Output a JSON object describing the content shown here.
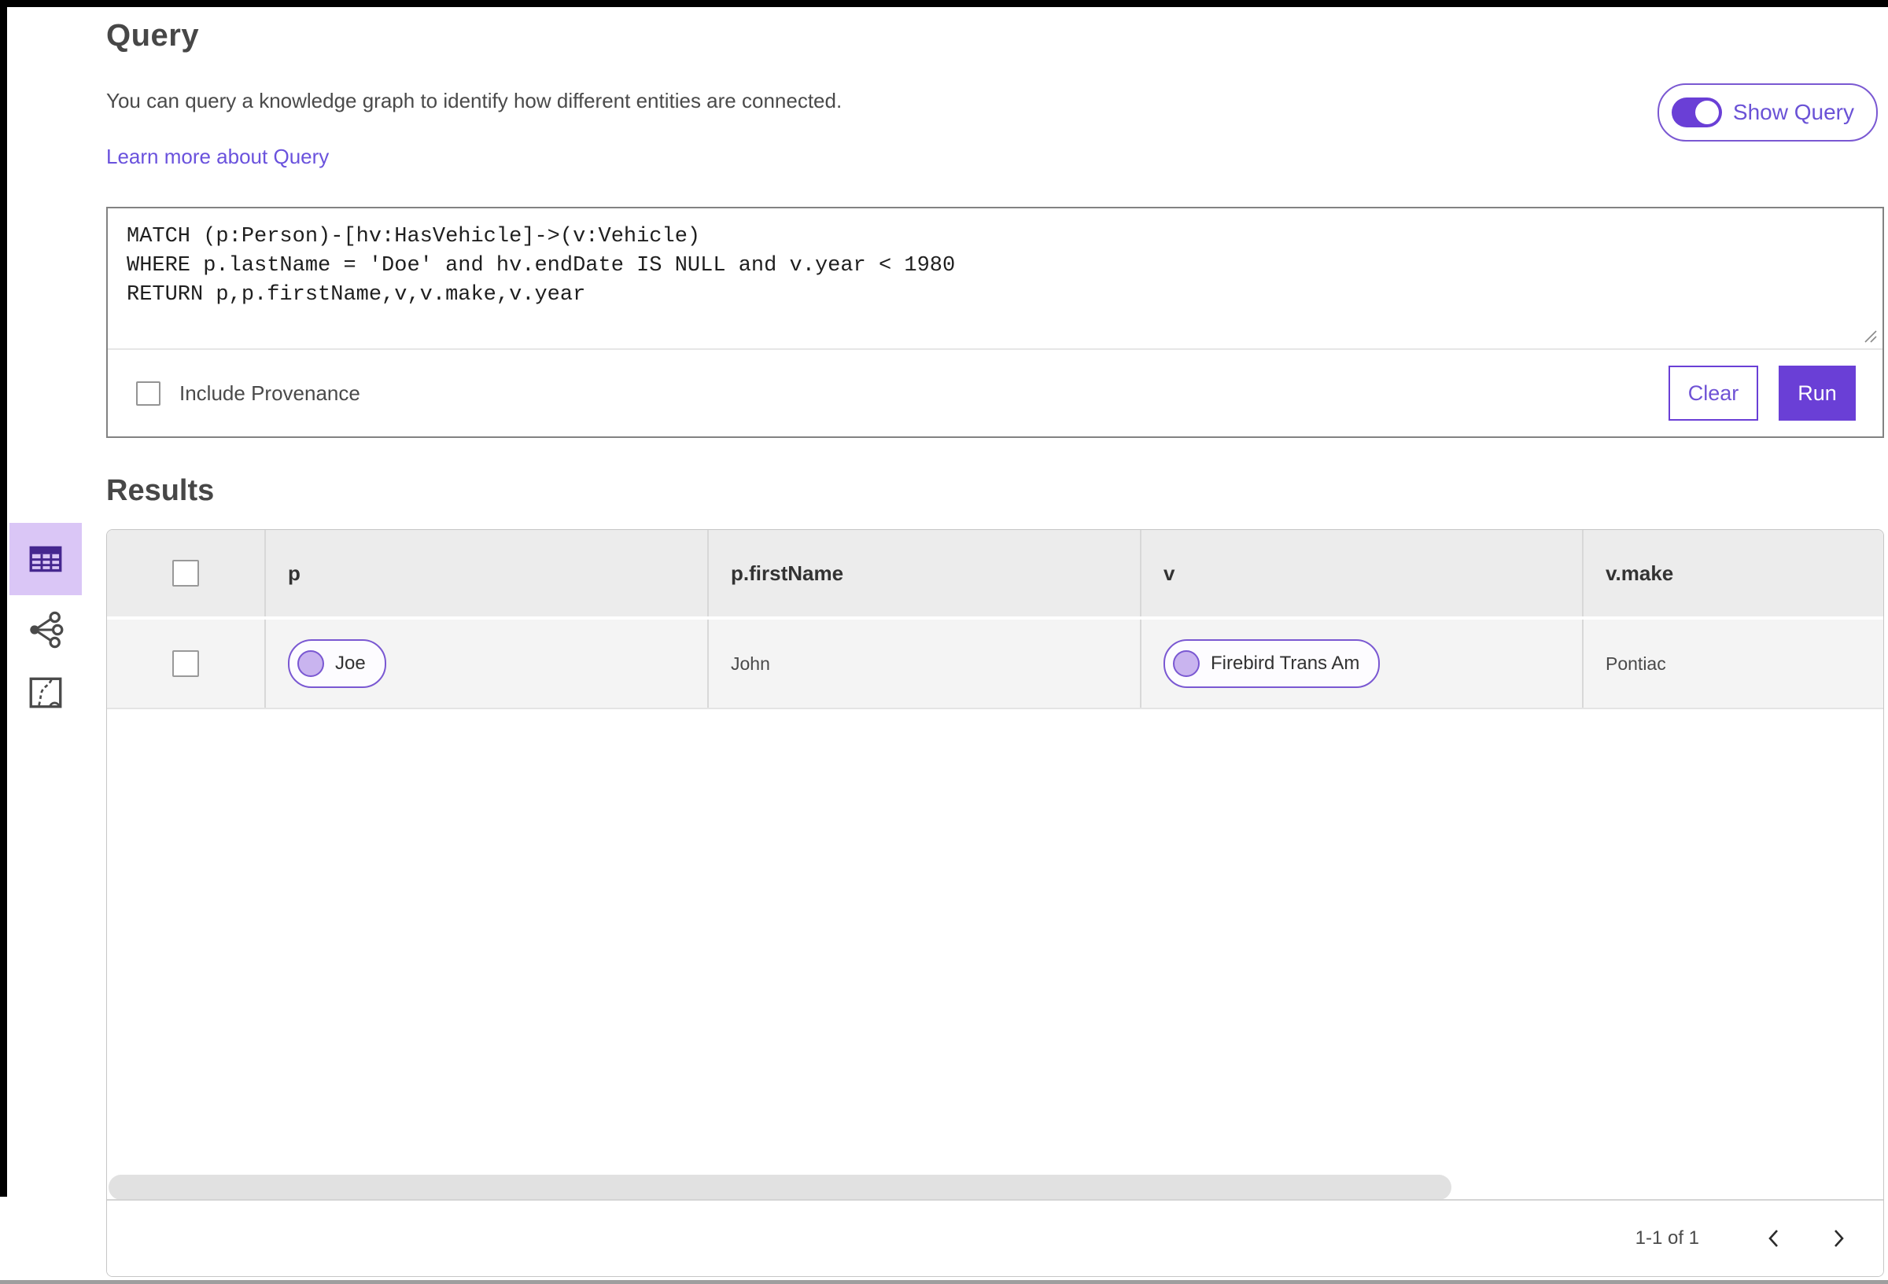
{
  "page": {
    "title": "Query",
    "description": "You can query a knowledge graph to identify how different entities are connected.",
    "learn_more_label": "Learn more about Query",
    "show_query_label": "Show Query"
  },
  "query_panel": {
    "query_text": "MATCH (p:Person)-[hv:HasVehicle]->(v:Vehicle)\nWHERE p.lastName = 'Doe' and hv.endDate IS NULL and v.year < 1980\nRETURN p,p.firstName,v,v.make,v.year",
    "include_provenance_label": "Include Provenance",
    "clear_label": "Clear",
    "run_label": "Run"
  },
  "results": {
    "heading": "Results",
    "views": [
      {
        "name": "table-view",
        "selected": true
      },
      {
        "name": "link-chart-view",
        "selected": false
      },
      {
        "name": "map-view",
        "selected": false
      }
    ],
    "table": {
      "columns": [
        "p",
        "p.firstName",
        "v",
        "v.make"
      ],
      "rows": [
        {
          "p": "Joe",
          "p_firstName": "John",
          "v": "Firebird Trans Am",
          "v_make": "Pontiac"
        }
      ],
      "pagination": {
        "range_label": "1-1 of 1"
      }
    }
  },
  "colors": {
    "primary_purple": "#6a3fd6",
    "selected_tile_purple": "#dac6f6",
    "pill_border_purple": "#7a58d2",
    "pill_dot_fill": "#c9b4ef",
    "link_purple": "#6a52dd",
    "table_header_gray": "#ececec",
    "table_row_gray": "#f4f4f4"
  }
}
